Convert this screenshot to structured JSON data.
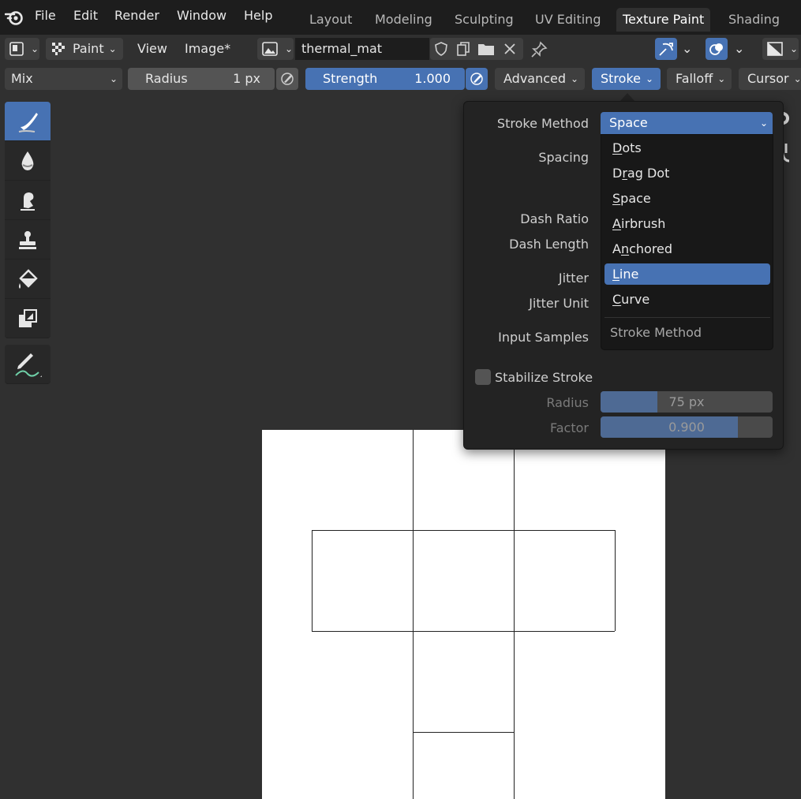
{
  "menu": {
    "items": [
      "File",
      "Edit",
      "Render",
      "Window",
      "Help"
    ]
  },
  "workspaces": {
    "tabs": [
      "Layout",
      "Modeling",
      "Sculpting",
      "UV Editing",
      "Texture Paint",
      "Shading"
    ],
    "active": "Texture Paint"
  },
  "header": {
    "mode_label": "Paint",
    "view_label": "View",
    "image_label": "Image*",
    "image_name": "thermal_mat"
  },
  "toolsettings": {
    "blend_mode": "Mix",
    "radius_label": "Radius",
    "radius_value": "1 px",
    "strength_label": "Strength",
    "strength_value": "1.000",
    "advanced_label": "Advanced",
    "stroke_label": "Stroke",
    "falloff_label": "Falloff",
    "cursor_label": "Cursor"
  },
  "popover": {
    "stroke_method_label": "Stroke Method",
    "stroke_method_value": "Space",
    "spacing_label": "Spacing",
    "dash_ratio_label": "Dash Ratio",
    "dash_length_label": "Dash Length",
    "jitter_label": "Jitter",
    "jitter_unit_label": "Jitter Unit",
    "input_samples_label": "Input Samples",
    "stabilize_label": "Stabilize Stroke",
    "stabilize_checked": false,
    "stab_radius_label": "Radius",
    "stab_radius_value": "75 px",
    "stab_radius_fraction": 0.33,
    "stab_factor_label": "Factor",
    "stab_factor_value": "0.900",
    "stab_factor_fraction": 0.8
  },
  "dropdown": {
    "items": [
      {
        "mnemonic": "D",
        "rest": "ots"
      },
      {
        "pre": "D",
        "mnemonic": "r",
        "rest": "ag Dot"
      },
      {
        "mnemonic": "S",
        "rest": "pace"
      },
      {
        "mnemonic": "A",
        "rest": "irbrush"
      },
      {
        "pre": "A",
        "mnemonic": "n",
        "rest": "chored"
      },
      {
        "mnemonic": "L",
        "rest": "ine"
      },
      {
        "mnemonic": "C",
        "rest": "urve"
      }
    ],
    "highlighted": "Line",
    "title": "Stroke Method"
  },
  "tools": [
    "draw-brush-icon",
    "soften-icon",
    "smear-icon",
    "clone-icon",
    "fill-icon",
    "mask-icon",
    "annotate-icon"
  ],
  "colors": {
    "accent": "#4772b3",
    "topbar": "#1d1d1d",
    "panel": "#303030",
    "popover": "#232323",
    "canvas": "#ffffff"
  }
}
